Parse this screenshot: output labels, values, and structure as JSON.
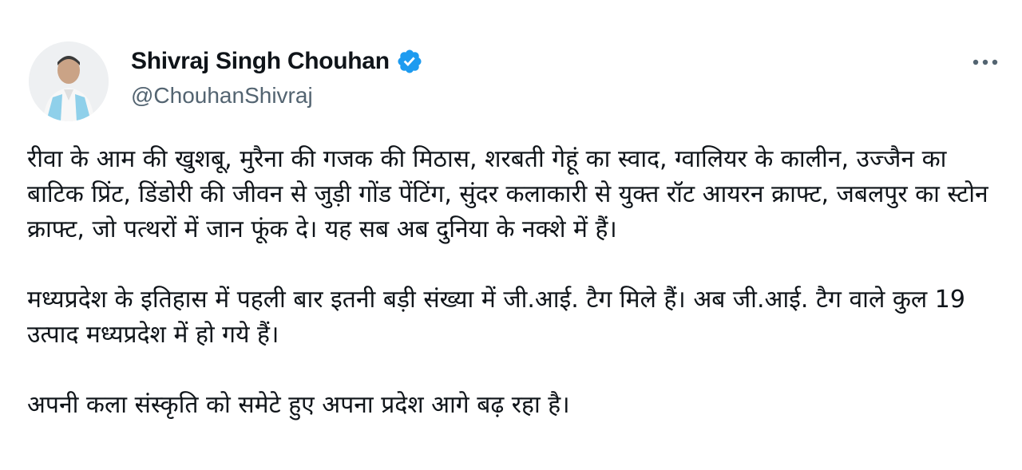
{
  "author": {
    "display_name": "Shivraj Singh Chouhan",
    "handle": "@ChouhanShivraj",
    "verified": true
  },
  "icons": {
    "verified": "verified-badge-icon",
    "more": "more-horizontal-icon",
    "avatar": "profile-photo"
  },
  "colors": {
    "text": "#0f1419",
    "secondary": "#536471",
    "verified_badge": "#1d9bf0"
  },
  "tweet": {
    "paragraphs": [
      "रीवा के आम की खुशबू, मुरैना की गजक की मिठास, शरबती गेहूं का स्वाद, ग्वालियर के कालीन, उज्जैन का बाटिक प्रिंट, डिंडोरी की जीवन से जुड़ी गोंड पेंटिंग, सुंदर कलाकारी से युक्त रॉट आयरन क्राफ्ट, जबलपुर का स्टोन क्राफ्ट, जो पत्थरों में जान फूंक दे। यह सब अब दुनिया के नक्शे में हैं।",
      "मध्यप्रदेश के इतिहास में पहली बार इतनी बड़ी संख्या में जी.आई. टैग मिले हैं। अब जी.आई. टैग वाले कुल 19 उत्पाद मध्यप्रदेश में हो गये हैं।",
      "अपनी कला संस्कृति को समेटे हुए अपना प्रदेश आगे बढ़ रहा है।"
    ]
  }
}
